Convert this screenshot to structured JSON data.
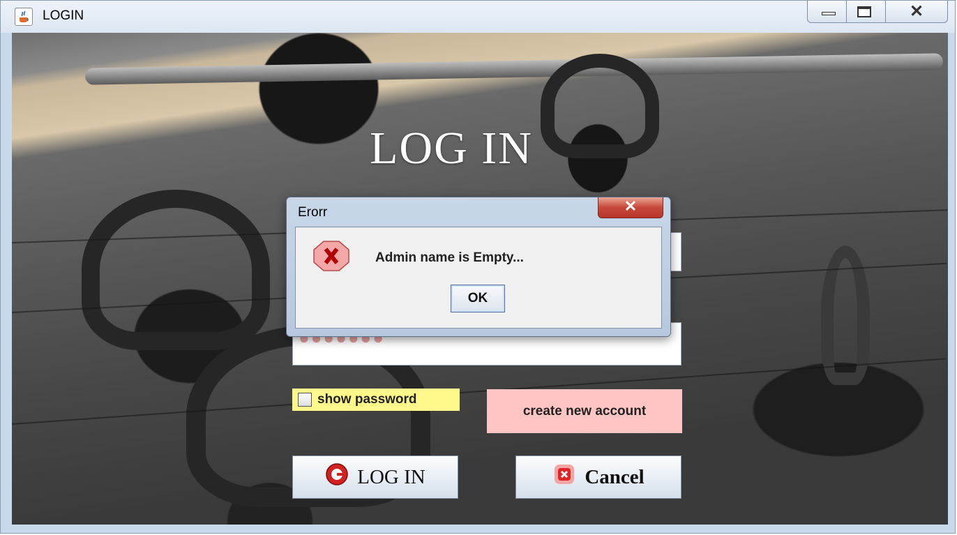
{
  "window": {
    "title": "LOGIN",
    "icon": "java-cup-icon",
    "controls": [
      "minimize-icon",
      "maximize-icon",
      "close-icon"
    ]
  },
  "form": {
    "heading": "LOG IN",
    "password_mask": "●●●●●●●",
    "show_password_label": "show password",
    "show_password_checked": false,
    "create_account_label": "create new account",
    "login_button_label": "LOG IN",
    "cancel_button_label": "Cancel"
  },
  "dialog": {
    "title": "Erorr",
    "message": "Admin name is Empty...",
    "ok_label": "OK",
    "icon": "error-icon",
    "close_glyph": "✕"
  },
  "colors": {
    "show_password_bg": "#fff88a",
    "create_account_bg": "#ffc4c4",
    "dialog_close_red": "#c8483a"
  }
}
